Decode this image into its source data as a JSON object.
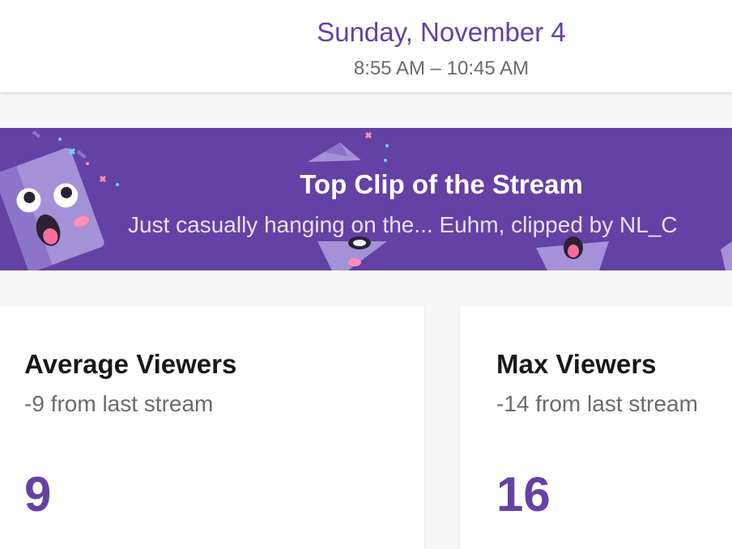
{
  "header": {
    "date": "Sunday, November 4",
    "time_range": "8:55 AM – 10:45 AM"
  },
  "top_clip": {
    "heading": "Top Clip of the Stream",
    "subtitle": "Just casually hanging on the... Euhm, clipped by NL_C"
  },
  "stats": {
    "average_viewers": {
      "label": "Average Viewers",
      "change": "-9 from last stream",
      "value": "9"
    },
    "max_viewers": {
      "label": "Max Viewers",
      "change": "-14 from last stream",
      "value": "16"
    }
  },
  "colors": {
    "accent": "#6441a5",
    "text_dark": "#19171c",
    "text_muted": "#6a6a6f",
    "background": "#f7f7f8"
  },
  "icons": [
    "glitch-mascot-icon",
    "sparkle-icon"
  ]
}
